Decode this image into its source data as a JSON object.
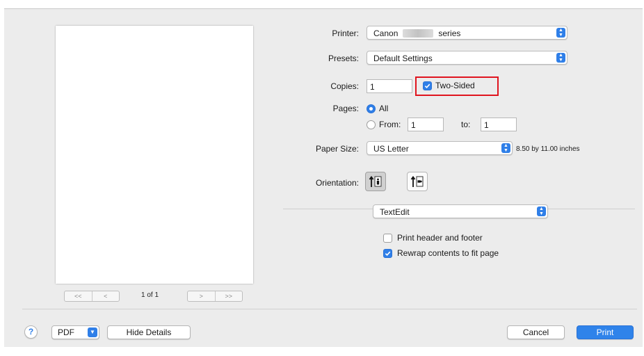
{
  "preview": {
    "first_prev": [
      "<<",
      "<"
    ],
    "next_last": [
      ">",
      ">>"
    ],
    "page_count": "1 of 1"
  },
  "printer": {
    "label": "Printer:",
    "value_prefix": "Canon",
    "value_suffix": "series"
  },
  "presets": {
    "label": "Presets:",
    "value": "Default Settings"
  },
  "copies": {
    "label": "Copies:",
    "value": "1"
  },
  "two_sided": {
    "label": "Two-Sided",
    "checked": true
  },
  "pages": {
    "label": "Pages:",
    "all_label": "All",
    "from_label": "From:",
    "from_value": "1",
    "to_label": "to:",
    "to_value": "1"
  },
  "paper_size": {
    "label": "Paper Size:",
    "value": "US Letter",
    "dimensions": "8.50 by 11.00 inches"
  },
  "orientation": {
    "label": "Orientation:",
    "selected": "portrait"
  },
  "app_section": {
    "value": "TextEdit"
  },
  "options": {
    "print_header_footer": {
      "label": "Print header and footer",
      "checked": false
    },
    "rewrap": {
      "label": "Rewrap contents to fit page",
      "checked": true
    }
  },
  "footer": {
    "help": "?",
    "pdf": "PDF",
    "hide_details": "Hide Details",
    "cancel": "Cancel",
    "print": "Print"
  },
  "colors": {
    "accent": "#2f7fe8",
    "highlight": "#e0141e"
  },
  "icons": [
    "chevron-updown-icon",
    "checkmark-icon",
    "portrait-icon",
    "landscape-icon",
    "help-icon"
  ]
}
